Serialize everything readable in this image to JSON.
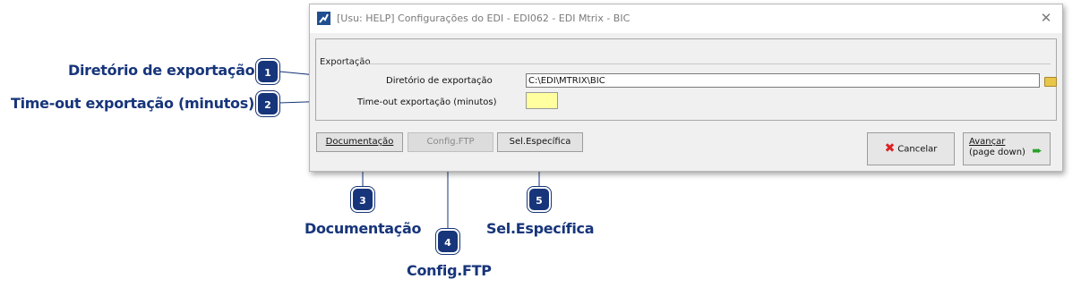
{
  "dialog": {
    "title": "[Usu: HELP] Configurações do EDI - EDI062 - EDI Mtrix - BIC",
    "close_glyph": "✕",
    "group_label": "Exportação",
    "directory_label": "Diretório  de exportação",
    "directory_value": "C:\\EDI\\MTRIX\\BIC",
    "timeout_label": "Time-out exportação (minutos)",
    "timeout_value": "",
    "buttons": {
      "documentation": "Documentação",
      "config_ftp": "Config.FTP",
      "sel_especifica": "Sel.Específica",
      "cancel": "Cancelar",
      "next_line1": "Avançar",
      "next_line2": "(page down)"
    },
    "icons": {
      "app": "app-icon",
      "folder": "folder-icon",
      "cancel": "x-icon",
      "next": "green-arrow-icon"
    }
  },
  "callouts": [
    {
      "number": "1",
      "label": "Diretório de exportação"
    },
    {
      "number": "2",
      "label": "Time-out exportação (minutos)"
    },
    {
      "number": "3",
      "label": "Documentação"
    },
    {
      "number": "4",
      "label": "Config.FTP"
    },
    {
      "number": "5",
      "label": "Sel.Específica"
    }
  ],
  "colors": {
    "callout": "#17357a",
    "timeout_field": "#ffffa0"
  }
}
